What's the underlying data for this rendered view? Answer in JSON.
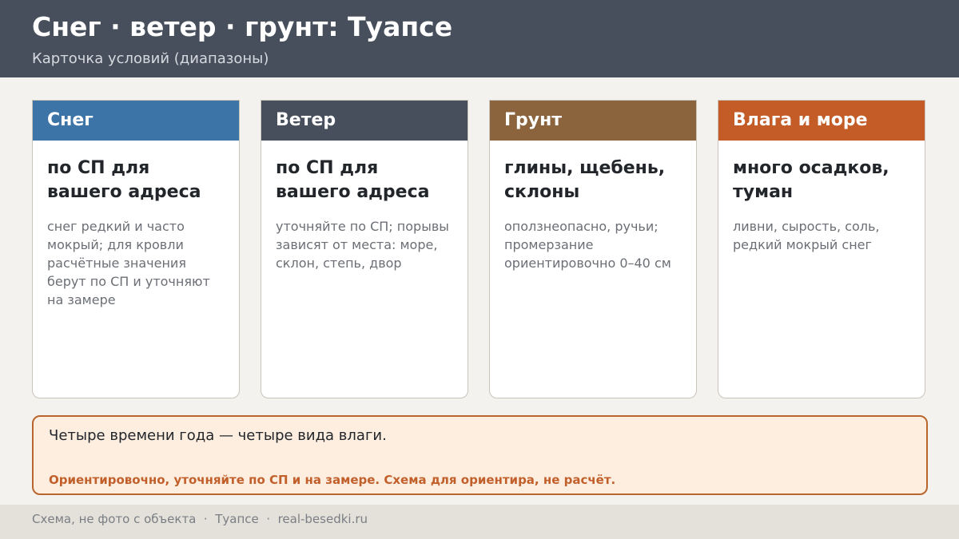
{
  "header": {
    "title": "Снег · ветер · грунт: Туапсе",
    "subtitle": "Карточка условий (диапазоны)"
  },
  "cards": [
    {
      "title": "Снег",
      "color": "#3d74a8",
      "main": "по СП для вашего адреса",
      "desc": "снег редкий и часто мокрый; для кровли расчётные значения берут по СП и уточняют на замере"
    },
    {
      "title": "Ветер",
      "color": "#464f5b",
      "main": "по СП для вашего адреса",
      "desc": "уточняйте по СП; порывы зависят от места: море, склон, степь, двор"
    },
    {
      "title": "Грунт",
      "color": "#8b643d",
      "main": "глины, щебень, склоны",
      "desc": "оползнеопасно, ручьи; промерзание ориентировочно 0–40 см"
    },
    {
      "title": "Влага и море",
      "color": "#c45c28",
      "main": "много осадков, туман",
      "desc": "ливни, сырость, соль, редкий мокрый снег"
    }
  ],
  "note": {
    "text": "Четыре времени года — четыре вида влаги.",
    "warning": "Ориентировочно, уточняйте по СП и на замере. Схема для ориентира, не расчёт."
  },
  "footer": {
    "line": "Схема, не фото с объекта  ·  Туапсе  ·  real-besedki.ru"
  }
}
